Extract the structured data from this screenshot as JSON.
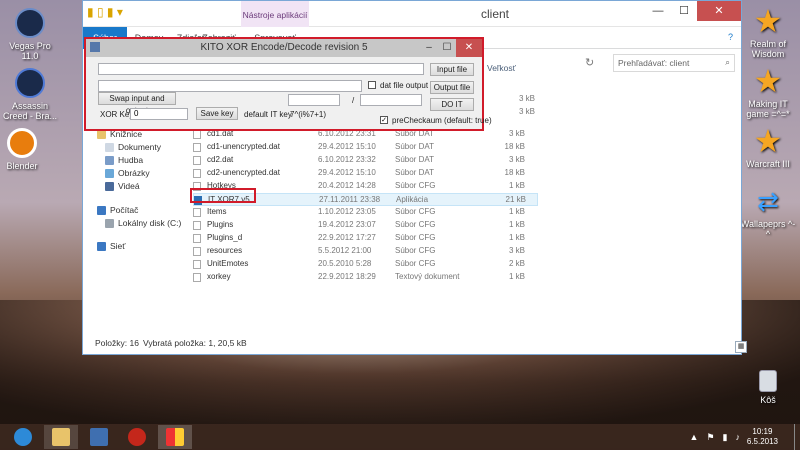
{
  "desktop": {
    "left_icons": [
      {
        "label": "Vegas Pro 11.0"
      },
      {
        "label": "Assassin Creed - Bra..."
      },
      {
        "label": "Blender"
      }
    ],
    "right_icons": [
      {
        "label": "Realm of Wisdom"
      },
      {
        "label": "Making IT game =^=*"
      },
      {
        "label": "Warcraft III"
      },
      {
        "label": "Wallapeprs ^-^"
      },
      {
        "label": "Kôš"
      }
    ]
  },
  "explorer": {
    "title": "client",
    "tools_tab": "Nástroje aplikácií",
    "tabs": [
      "Súbor",
      "Domov",
      "Zdieľať",
      "Zobraziť",
      "Spravovať"
    ],
    "search_placeholder": "Prehľadávať: client",
    "column_size": "Veľkosť",
    "nav": [
      {
        "label": "Knižnice"
      },
      {
        "label": "Dokumenty"
      },
      {
        "label": "Hudba"
      },
      {
        "label": "Obrázky"
      },
      {
        "label": "Videá"
      },
      {
        "label": "Počítač"
      },
      {
        "label": "Lokálny disk (C:)"
      },
      {
        "label": "Sieť"
      }
    ],
    "files": [
      {
        "name": "cd1.dat",
        "date": "6.10.2012 23:31",
        "type": "Súbor DAT",
        "size": "3 kB"
      },
      {
        "name": "cd1-unencrypted.dat",
        "date": "29.4.2012 15:10",
        "type": "Súbor DAT",
        "size": "18 kB"
      },
      {
        "name": "cd2.dat",
        "date": "6.10.2012 23:32",
        "type": "Súbor DAT",
        "size": "3 kB"
      },
      {
        "name": "cd2-unencrypted.dat",
        "date": "29.4.2012 15:10",
        "type": "Súbor DAT",
        "size": "18 kB"
      },
      {
        "name": "Hotkeys",
        "date": "20.4.2012 14:28",
        "type": "Súbor CFG",
        "size": "1 kB"
      },
      {
        "name": "IT XOR7 v5",
        "date": "27.11.2011 23:38",
        "type": "Aplikácia",
        "size": "21 kB"
      },
      {
        "name": "Items",
        "date": "1.10.2012 23:05",
        "type": "Súbor CFG",
        "size": "1 kB"
      },
      {
        "name": "Plugins",
        "date": "19.4.2012 23:07",
        "type": "Súbor CFG",
        "size": "1 kB"
      },
      {
        "name": "Plugins_d",
        "date": "22.9.2012 17:27",
        "type": "Súbor CFG",
        "size": "1 kB"
      },
      {
        "name": "resources",
        "date": "5.5.2012 21:00",
        "type": "Súbor CFG",
        "size": "3 kB"
      },
      {
        "name": "UnitEmotes",
        "date": "20.5.2010 5:28",
        "type": "Súbor CFG",
        "size": "2 kB"
      },
      {
        "name": "xorkey",
        "date": "22.9.2012 18:29",
        "type": "Textový dokument",
        "size": "1 kB"
      }
    ],
    "partial_sizes": [
      "3 kB",
      "3 kB"
    ],
    "status_items": "Položky: 16",
    "status_selected": "Vybratá položka: 1, 20,5 kB"
  },
  "kito": {
    "title": "KITO XOR Encode/Decode revision 5",
    "input_file_btn": "Input file",
    "output_file_btn": "Output file",
    "do_it_btn": "DO IT",
    "dat_file_output": "dat file output",
    "swap_btn": "Swap input and output",
    "xor_key_label": "XOR Key",
    "xor_key_value": "0",
    "save_key_btn": "Save key",
    "default_it_key_label": "default IT key",
    "default_it_key_value": "7^(i%7+1)",
    "slash": "/",
    "precheck_label": "preCheckaum (default: true)",
    "precheck_checked": true
  },
  "taskbar": {
    "time": "10:19",
    "date": "6.5.2013"
  }
}
